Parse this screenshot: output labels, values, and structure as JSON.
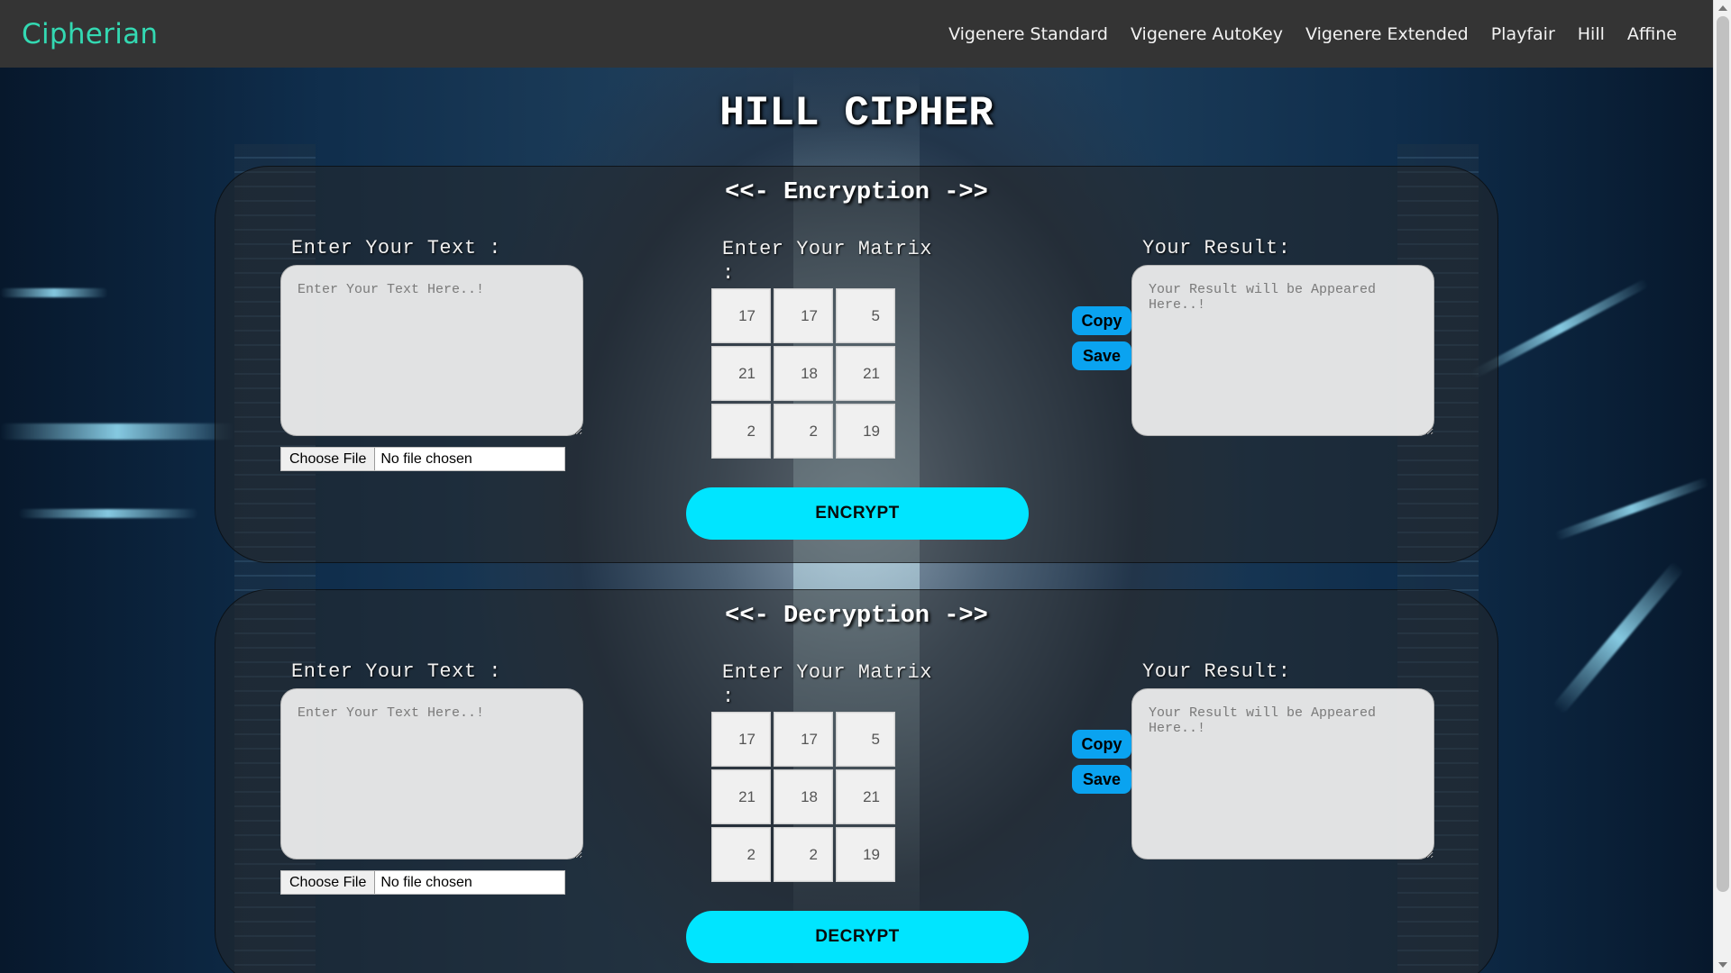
{
  "app": {
    "brand": "Cipherian"
  },
  "nav": [
    {
      "label": "Vigenere Standard"
    },
    {
      "label": "Vigenere AutoKey"
    },
    {
      "label": "Vigenere Extended"
    },
    {
      "label": "Playfair"
    },
    {
      "label": "Hill"
    },
    {
      "label": "Affine"
    }
  ],
  "page": {
    "title": "HILL CIPHER"
  },
  "encryption": {
    "title": "<<- Encryption ->>",
    "text_label": "Enter Your Text :",
    "text_placeholder": "Enter Your Text Here..!",
    "file_button": "Choose File",
    "file_status": "No file chosen",
    "matrix_label": "Enter Your Matrix :",
    "matrix": [
      "17",
      "17",
      "5",
      "21",
      "18",
      "21",
      "2",
      "2",
      "19"
    ],
    "result_label": "Your Result:",
    "result_placeholder": "Your Result will be Appeared Here..!",
    "copy_label": "Copy",
    "save_label": "Save",
    "action_label": "ENCRYPT"
  },
  "decryption": {
    "title": "<<- Decryption ->>",
    "text_label": "Enter Your Text :",
    "text_placeholder": "Enter Your Text Here..!",
    "file_button": "Choose File",
    "file_status": "No file chosen",
    "matrix_label": "Enter Your Matrix :",
    "matrix": [
      "17",
      "17",
      "5",
      "21",
      "18",
      "21",
      "2",
      "2",
      "19"
    ],
    "result_label": "Your Result:",
    "result_placeholder": "Your Result will be Appeared Here..!",
    "copy_label": "Copy",
    "save_label": "Save",
    "action_label": "DECRYPT"
  }
}
